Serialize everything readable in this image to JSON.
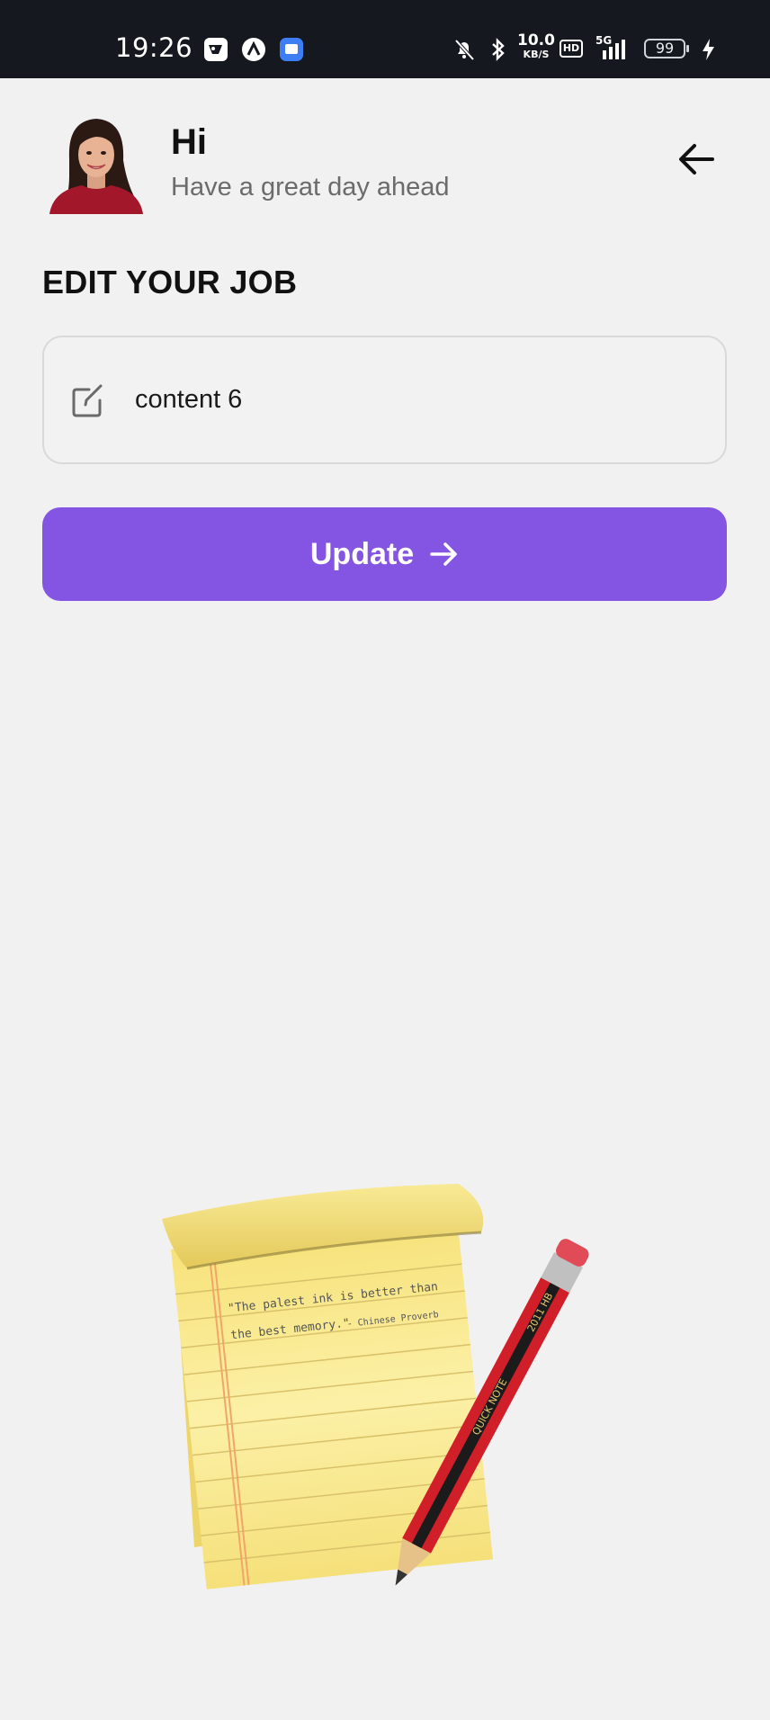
{
  "status_bar": {
    "time": "19:26",
    "net_speed": "10.0",
    "net_unit": "KB/S",
    "hd_label": "HD",
    "network": "5G",
    "battery": "99"
  },
  "header": {
    "title": "Hi",
    "subtitle": "Have a great day ahead"
  },
  "page": {
    "section_title": "EDIT YOUR JOB"
  },
  "job_input": {
    "value": "content 6"
  },
  "update_button": {
    "label": "Update"
  },
  "illustration": {
    "quote_line1": "\"The palest ink is better than",
    "quote_line2": "the best memory.\"",
    "quote_author": "- Chinese Proverb",
    "pencil_brand": "QUICK NOTE",
    "pencil_grade": "2011 HB"
  },
  "colors": {
    "accent": "#8455e2",
    "background": "#f2f1f2",
    "status_bar": "#15181e"
  }
}
